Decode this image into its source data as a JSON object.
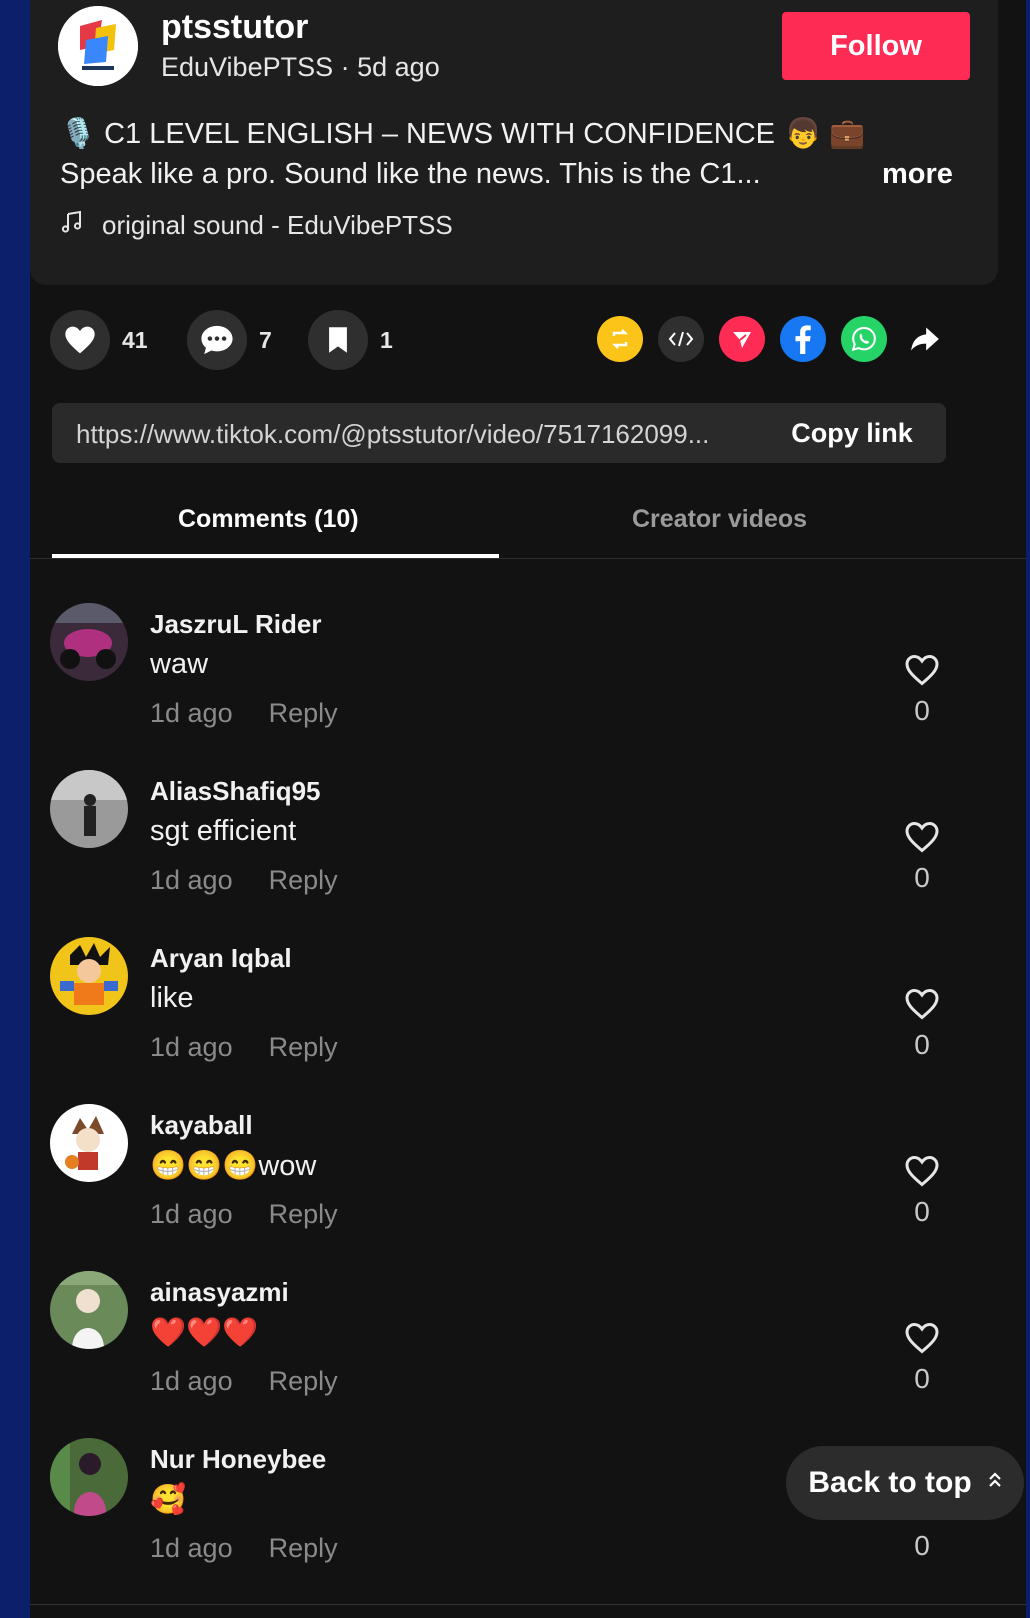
{
  "post": {
    "username": "ptsstutor",
    "handle": "EduVibePTSS",
    "separator": " · ",
    "time": "5d ago",
    "follow_label": "Follow",
    "title": "C1 LEVEL ENGLISH – NEWS WITH CONFIDENCE",
    "description": "Speak like a pro. Sound like the news. This is the C1...",
    "more_label": "more",
    "sound": "original sound - EduVibePTSS"
  },
  "actions": {
    "likes": "41",
    "comments": "7",
    "saves": "1"
  },
  "share": {
    "icons": [
      "repost-icon",
      "embed-icon",
      "send-icon",
      "facebook-icon",
      "whatsapp-icon",
      "share-arrow-icon"
    ],
    "colors": {
      "repost": "#fcc419",
      "embed": "#2f2f2f",
      "send": "#fe2c55",
      "facebook": "#1877f2",
      "whatsapp": "#25d366"
    }
  },
  "link": {
    "url": "https://www.tiktok.com/@ptsstutor/video/7517162099...",
    "copy_label": "Copy link"
  },
  "tabs": {
    "comments": "Comments (10)",
    "creator_videos": "Creator videos"
  },
  "comments": [
    {
      "name": "JaszruL Rider",
      "text": "waw",
      "time": "1d ago",
      "reply": "Reply",
      "likes": "0"
    },
    {
      "name": "AliasShafiq95",
      "text": "sgt efficient",
      "time": "1d ago",
      "reply": "Reply",
      "likes": "0"
    },
    {
      "name": "Aryan Iqbal",
      "text": "like",
      "time": "1d ago",
      "reply": "Reply",
      "likes": "0"
    },
    {
      "name": "kayaball",
      "text": "😁😁😁wow",
      "time": "1d ago",
      "reply": "Reply",
      "likes": "0"
    },
    {
      "name": "ainasyazmi",
      "text": "❤️❤️❤️",
      "time": "1d ago",
      "reply": "Reply",
      "likes": "0"
    },
    {
      "name": "Nur Honeybee",
      "text": "🥰",
      "time": "1d ago",
      "reply": "Reply",
      "likes": "0"
    }
  ],
  "back_to_top": "Back to top",
  "brand_color": "#fe2c55"
}
